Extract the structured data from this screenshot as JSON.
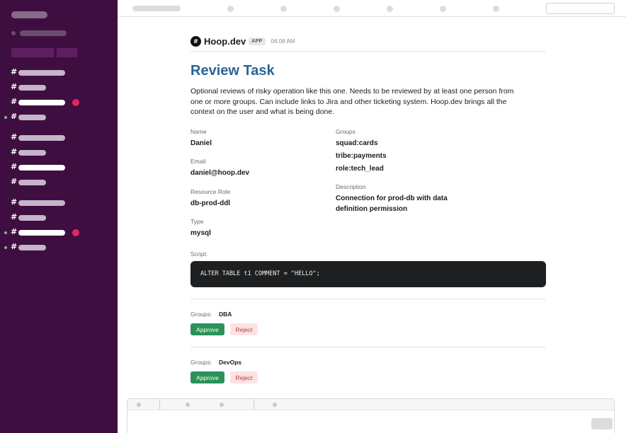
{
  "message": {
    "app_icon": "#",
    "app_name": "Hoop.dev",
    "app_badge": "APP",
    "time": "06:08 AM",
    "title": "Review Task",
    "description": "Optional reviews of risky operation like this one. Needs to be reviewed by at least one person from one or more groups. Can include links to Jira and other ticketing system. Hoop.dev brings all the context on the user and what is being done."
  },
  "fields": {
    "name_label": "Name",
    "name_value": "Daniel",
    "email_label": "Email",
    "email_value": "daniel@hoop.dev",
    "role_label": "Resource Role",
    "role_value": "db-prod-ddl",
    "type_label": "Type",
    "type_value": "mysql",
    "groups_label": "Groups",
    "groups_values": [
      "squad:cards",
      "tribe:payments",
      "role:tech_lead"
    ],
    "description_label": "Description",
    "description_value": "Connection for prod-db with data definition permission"
  },
  "script": {
    "label": "Script:",
    "code": "ALTER TABLE t1 COMMENT = \"HELLO\";"
  },
  "reviews": [
    {
      "label": "Groups:",
      "group": "DBA",
      "approve": "Approve",
      "reject": "Reject"
    },
    {
      "label": "Groups:",
      "group": "DevOps",
      "approve": "Approve",
      "reject": "Reject"
    }
  ],
  "sidebar": {
    "channel_glyph": "#"
  },
  "icons": {
    "app": "hoop-logo-icon",
    "channel": "hash-icon"
  },
  "colors": {
    "sidebar_bg": "#3f0e40",
    "title": "#2a6496",
    "approve": "#2b9258",
    "reject_bg": "#fbe3e5",
    "reject_text": "#c0392b",
    "unread_badge": "#dd2a5b",
    "code_bg": "#1d1f21"
  }
}
